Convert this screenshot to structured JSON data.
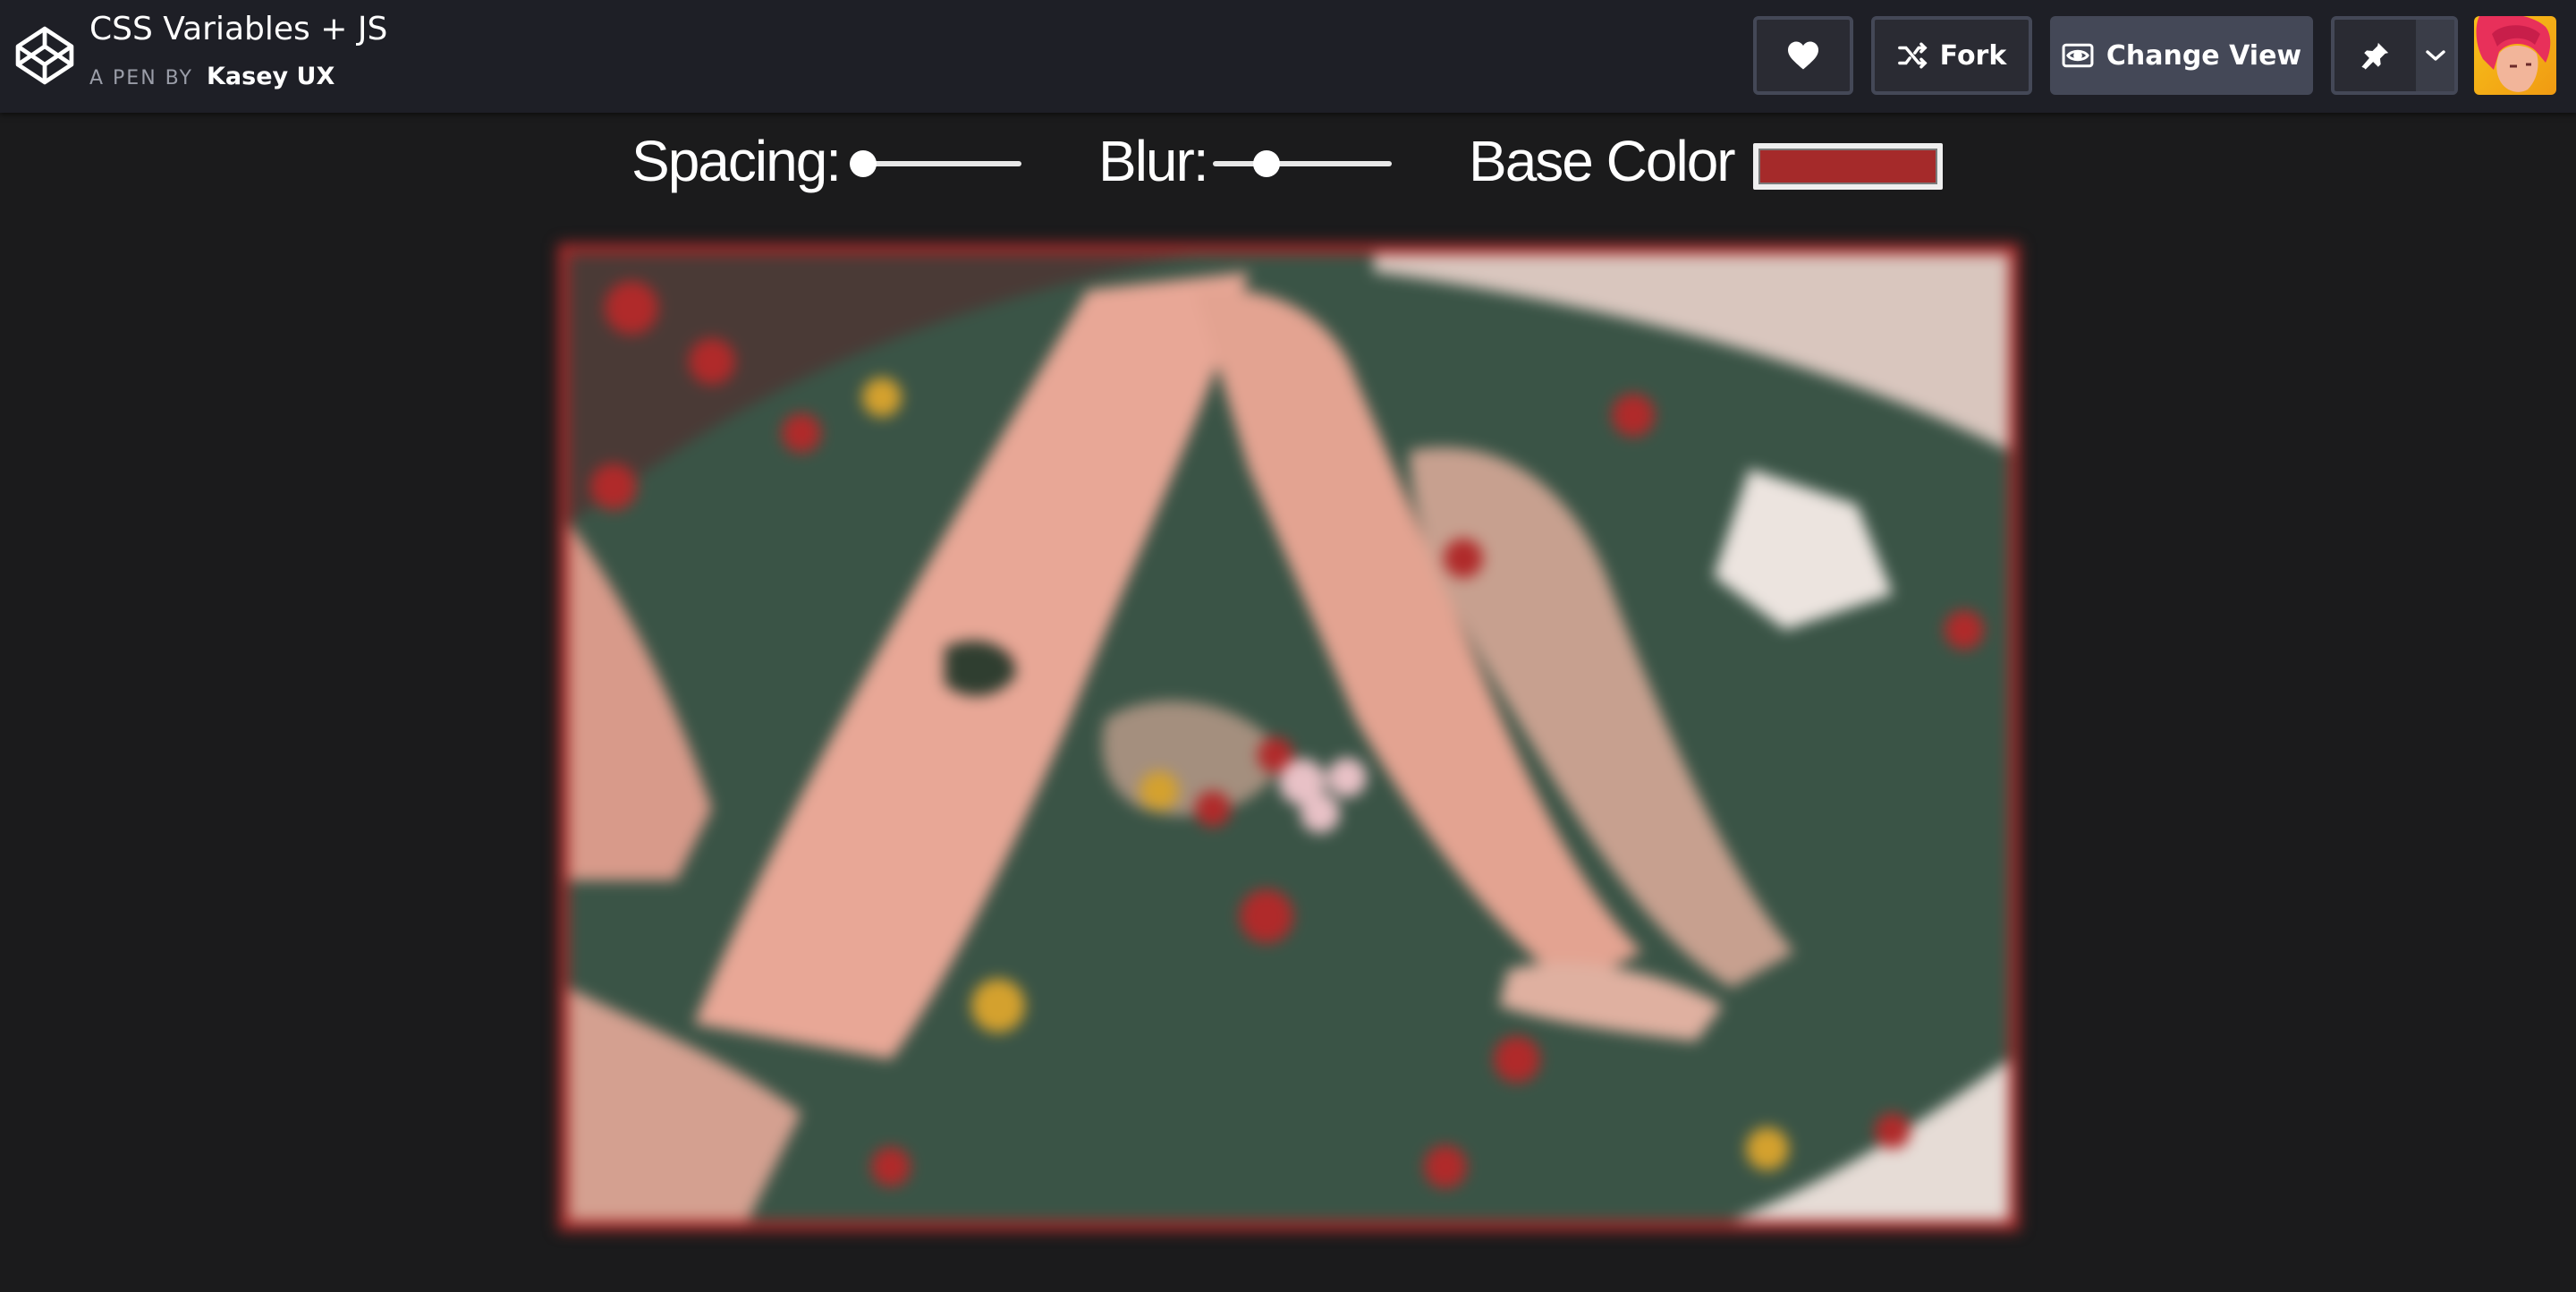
{
  "app": {
    "pen_title": "CSS Variables + JS",
    "pen_by_label": "A PEN BY",
    "author": "Kasey UX"
  },
  "toolbar": {
    "heart_icon": "heart-icon",
    "fork_label": "Fork",
    "fork_icon": "fork-icon",
    "change_view_label": "Change View",
    "change_view_icon": "eye-icon",
    "pin_icon": "pin-icon",
    "dropdown_icon": "chevron-down-icon"
  },
  "controls": {
    "spacing_label": "Spacing:",
    "spacing_value": 0,
    "blur_label": "Blur:",
    "blur_value": 0.3,
    "base_color_label": "Base Color",
    "base_color_value": "#a52a2a"
  },
  "colors": {
    "topbar_bg": "#1e1f26",
    "page_bg": "#1b1b1c",
    "button_border": "#444857",
    "accent": "#a52a2a"
  }
}
